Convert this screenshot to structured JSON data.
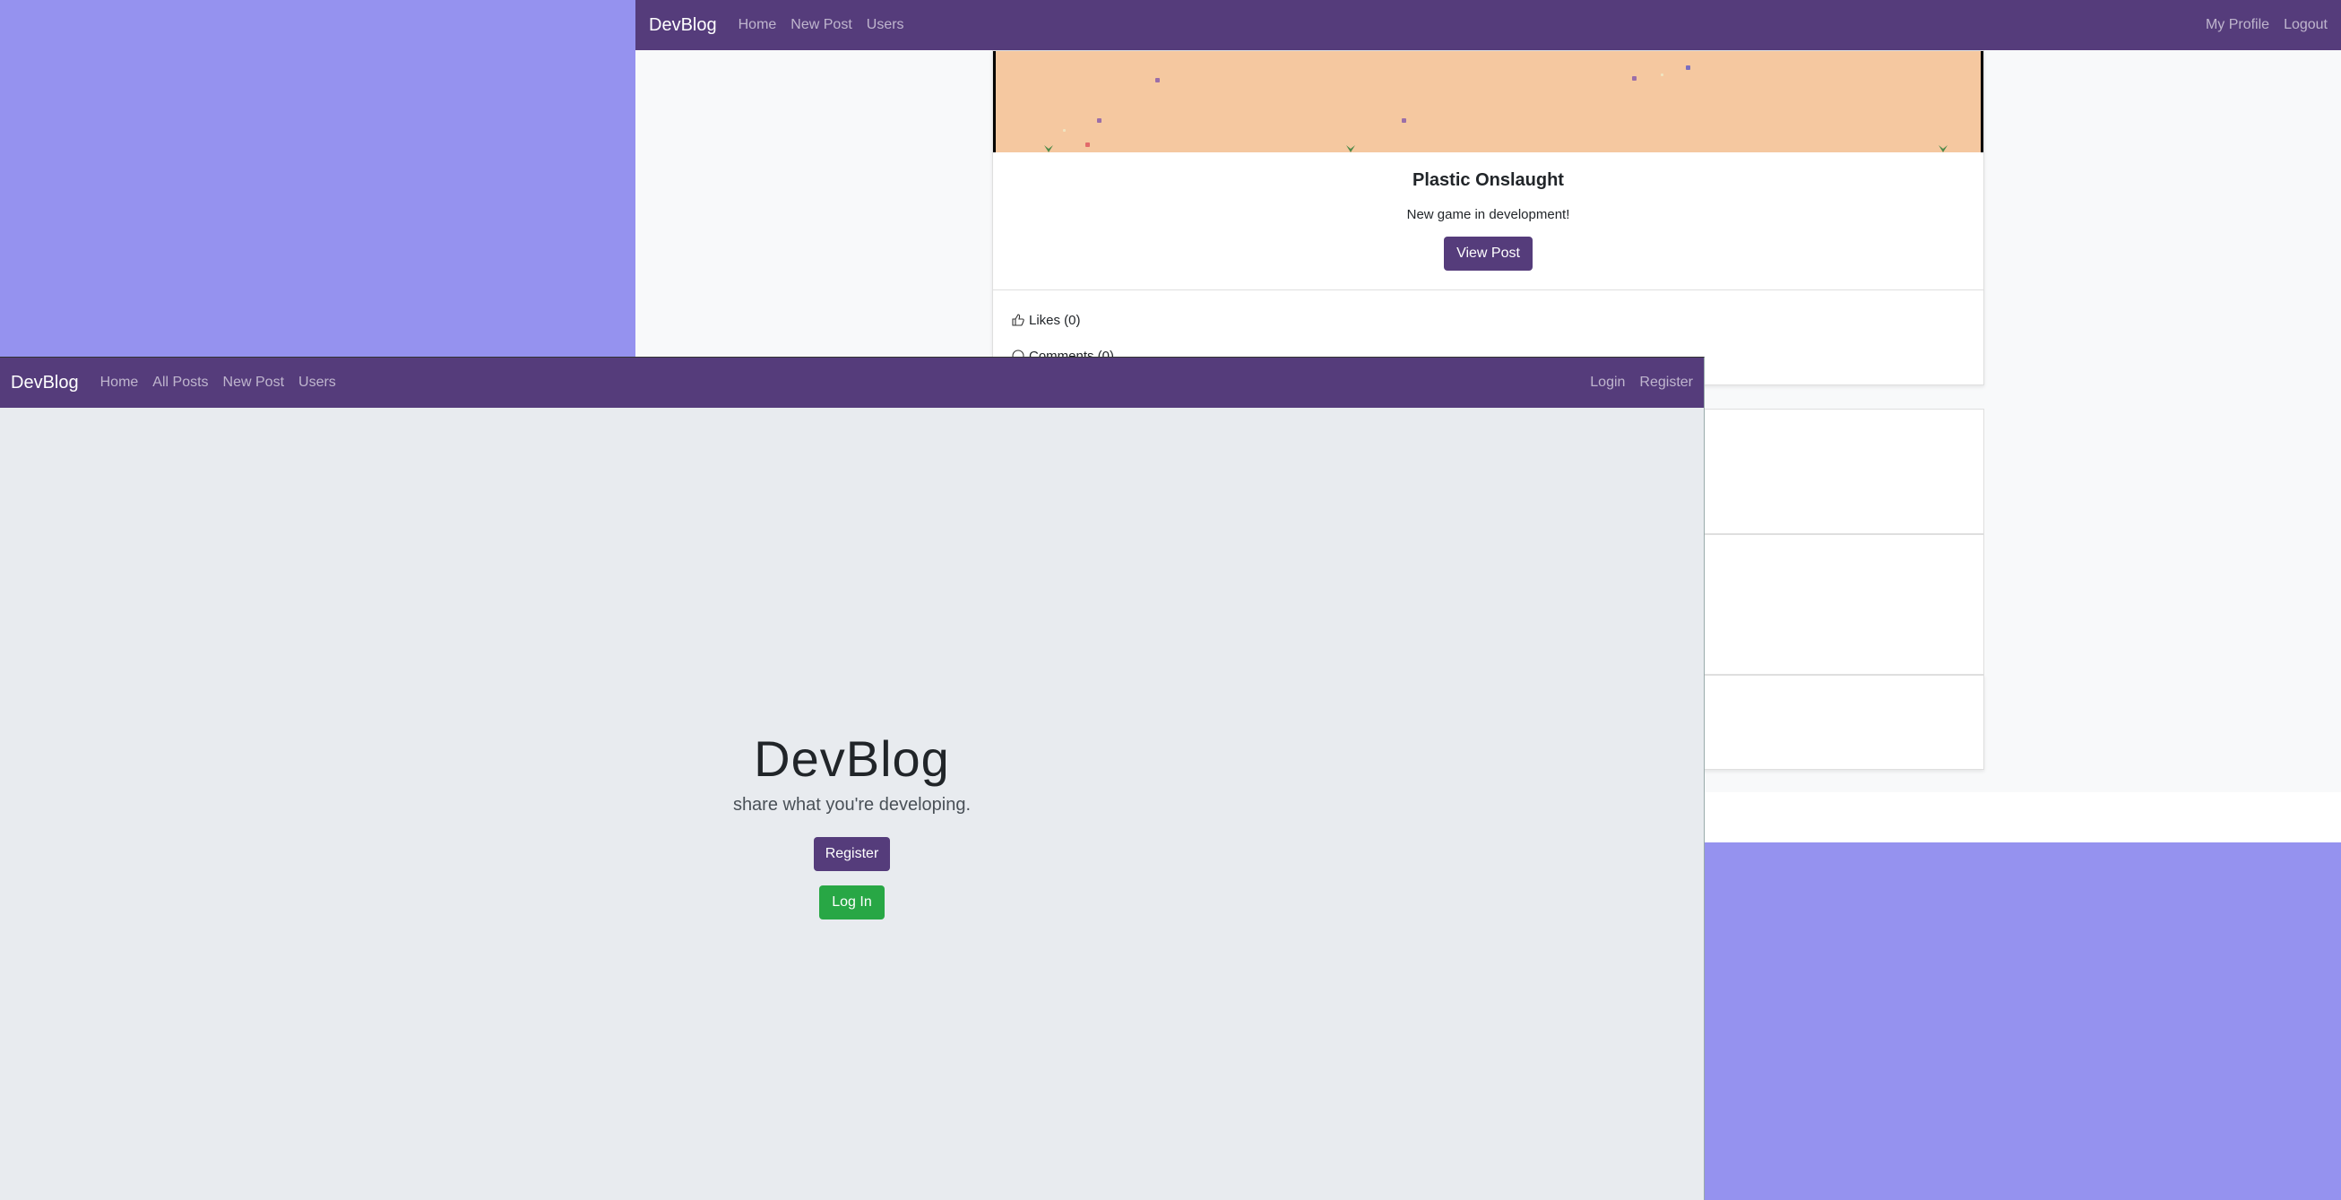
{
  "back_window": {
    "navbar": {
      "brand": "DevBlog",
      "links": [
        "Home",
        "New Post",
        "Users"
      ],
      "right_links": [
        "My Profile",
        "Logout"
      ]
    },
    "post": {
      "title": "Plastic Onslaught",
      "description": "New game in development!",
      "view_button": "View Post",
      "likes": "Likes (0)",
      "comments": "Comments (0)"
    }
  },
  "front_window": {
    "navbar": {
      "brand": "DevBlog",
      "links": [
        "Home",
        "All Posts",
        "New Post",
        "Users"
      ],
      "right_links": [
        "Login",
        "Register"
      ]
    },
    "hero": {
      "title": "DevBlog",
      "subtitle": "share what you're developing.",
      "register_button": "Register",
      "login_button": "Log In"
    }
  },
  "colors": {
    "desktop": "#9592ef",
    "navbar": "#553c7b",
    "primary_button": "#553c7b",
    "success_button": "#28a745",
    "post_image_bg": "#f5c8a0"
  }
}
